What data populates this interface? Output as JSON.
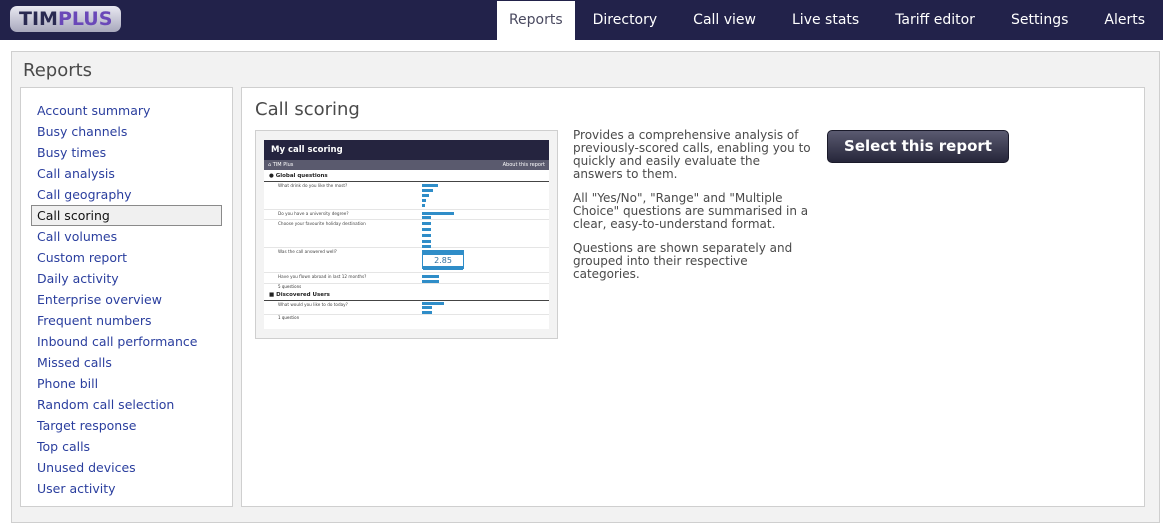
{
  "brand": {
    "part1": "TIM",
    "part2": "PLUS"
  },
  "nav": {
    "tabs": [
      {
        "label": "Reports",
        "active": true
      },
      {
        "label": "Directory"
      },
      {
        "label": "Call view"
      },
      {
        "label": "Live stats"
      },
      {
        "label": "Tariff editor"
      },
      {
        "label": "Settings"
      },
      {
        "label": "Alerts"
      }
    ]
  },
  "page": {
    "title": "Reports"
  },
  "sidebar": {
    "items": [
      {
        "label": "Account summary"
      },
      {
        "label": "Busy channels"
      },
      {
        "label": "Busy times"
      },
      {
        "label": "Call analysis"
      },
      {
        "label": "Call geography"
      },
      {
        "label": "Call scoring",
        "active": true
      },
      {
        "label": "Call volumes"
      },
      {
        "label": "Custom report"
      },
      {
        "label": "Daily activity"
      },
      {
        "label": "Enterprise overview"
      },
      {
        "label": "Frequent numbers"
      },
      {
        "label": "Inbound call performance"
      },
      {
        "label": "Missed calls"
      },
      {
        "label": "Phone bill"
      },
      {
        "label": "Random call selection"
      },
      {
        "label": "Target response"
      },
      {
        "label": "Top calls"
      },
      {
        "label": "Unused devices"
      },
      {
        "label": "User activity"
      }
    ]
  },
  "report": {
    "title": "Call scoring",
    "description": [
      "Provides a comprehensive analysis of previously-scored calls, enabling you to quickly and easily evaluate the answers to them.",
      "All \"Yes/No\", \"Range\" and \"Multiple Choice\" questions are summarised in a clear, easy-to-understand format.",
      "Questions are shown separately and grouped into their respective categories."
    ],
    "select_label": "Select this report",
    "preview": {
      "title": "My call scoring",
      "breadcrumb": "TIM Plus",
      "about": "About this report",
      "section1": "Global questions",
      "questions": [
        "What drink do you like the most?",
        "Do you have a university degree?",
        "Choose your favourite holiday destination",
        "Was the call answered well?",
        "Have you flown abroad in last 12 months?"
      ],
      "range_value": "2.85",
      "footer1": "5 questions",
      "section2": "Discovered Users",
      "question_du": "What would you like to do today?",
      "footer2": "1 question"
    }
  },
  "colors": {
    "topbar": "#22224a",
    "link": "#2a3e9e",
    "accent_bar": "#2f8dc8"
  }
}
